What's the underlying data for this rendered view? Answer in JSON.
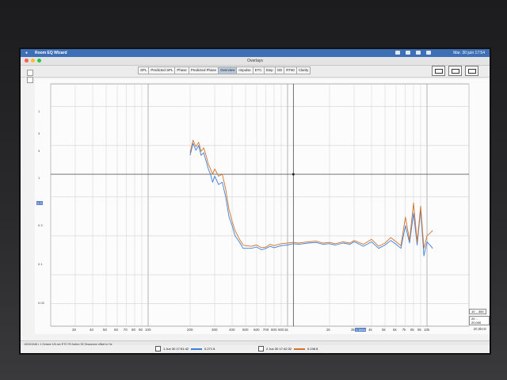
{
  "menubar": {
    "app_name": "Room EQ Wizard",
    "status_time": "Mar. 30 juin  17:54"
  },
  "window": {
    "title": "Overlays"
  },
  "tabs": [
    {
      "label": "SPL"
    },
    {
      "label": "Predicted SPL"
    },
    {
      "label": "Phase"
    },
    {
      "label": "Predicted Phase"
    },
    {
      "label": "Overview",
      "active": true
    },
    {
      "label": "Impulse"
    },
    {
      "label": "ETC"
    },
    {
      "label": "Step"
    },
    {
      "label": "GD"
    },
    {
      "label": "RT60"
    },
    {
      "label": "Clarity"
    }
  ],
  "y_axis_labels": [
    "1",
    "3",
    "3",
    "1",
    "0.3",
    "0.1",
    "0.03"
  ],
  "cursor": {
    "y_value": "0.3",
    "x_value": "1.1kHz"
  },
  "x_axis_labels": [
    "30",
    "40",
    "50",
    "60",
    "70",
    "80",
    "90",
    "100",
    "200",
    "300",
    "400",
    "500",
    "600",
    "700",
    "800",
    "900",
    "1k",
    "2k",
    "3k",
    "4k",
    "5k",
    "6k",
    "7k",
    "8k",
    "9k",
    "10k"
  ],
  "x_unit": "20,0kHz",
  "range_buttons": [
    "10 .. 300",
    "20 .. 20,000"
  ],
  "statusbar": {
    "text": "1024/1048  •  1 Octave 1/6 per  ETC+R  Action 35 Sequence  offset in  Hz"
  },
  "legend": [
    {
      "label": "1 Jun 30 17:51:42",
      "value": "0.271 8",
      "color": "#3d7fd9"
    },
    {
      "label": "2 Jun 30 17:42:32",
      "value": "0.246 8",
      "color": "#d1732c"
    }
  ],
  "chart_data": {
    "type": "line",
    "xscale": "log",
    "xlim": [
      20,
      20000
    ],
    "series": [
      {
        "color": "#3d7fd9",
        "x": [
          200,
          210,
          220,
          230,
          240,
          250,
          260,
          270,
          280,
          290,
          300,
          320,
          340,
          360,
          380,
          400,
          420,
          450,
          480,
          500,
          550,
          600,
          650,
          700,
          750,
          800,
          900,
          1000,
          1100,
          1200,
          1400,
          1600,
          1800,
          2000,
          2200,
          2500,
          2800,
          3000,
          3500,
          4000,
          4500,
          5000,
          5500,
          6000,
          6500,
          7000,
          7500,
          8000,
          8500,
          9000,
          9500,
          10000,
          11000
        ],
        "y": [
          0.42,
          0.52,
          0.46,
          0.5,
          0.42,
          0.44,
          0.38,
          0.33,
          0.3,
          0.26,
          0.29,
          0.25,
          0.26,
          0.2,
          0.14,
          0.12,
          0.1,
          0.09,
          0.08,
          0.08,
          0.08,
          0.082,
          0.078,
          0.08,
          0.083,
          0.081,
          0.084,
          0.085,
          0.087,
          0.086,
          0.088,
          0.089,
          0.086,
          0.087,
          0.085,
          0.088,
          0.086,
          0.09,
          0.083,
          0.09,
          0.08,
          0.085,
          0.092,
          0.086,
          0.08,
          0.12,
          0.088,
          0.15,
          0.085,
          0.16,
          0.07,
          0.09,
          0.08
        ]
      },
      {
        "color": "#d1732c",
        "x": [
          200,
          210,
          220,
          230,
          240,
          250,
          260,
          270,
          280,
          290,
          300,
          320,
          340,
          360,
          380,
          400,
          420,
          450,
          480,
          500,
          550,
          600,
          650,
          700,
          750,
          800,
          900,
          1000,
          1100,
          1200,
          1400,
          1600,
          1800,
          2000,
          2200,
          2500,
          2800,
          3000,
          3500,
          4000,
          4500,
          5000,
          5500,
          6000,
          6500,
          7000,
          7500,
          8000,
          8500,
          9000,
          9500,
          10000,
          11000
        ],
        "y": [
          0.44,
          0.55,
          0.49,
          0.53,
          0.45,
          0.48,
          0.42,
          0.36,
          0.33,
          0.3,
          0.33,
          0.29,
          0.3,
          0.23,
          0.16,
          0.13,
          0.11,
          0.095,
          0.085,
          0.084,
          0.083,
          0.085,
          0.081,
          0.082,
          0.086,
          0.084,
          0.087,
          0.088,
          0.089,
          0.088,
          0.09,
          0.091,
          0.088,
          0.089,
          0.087,
          0.09,
          0.088,
          0.092,
          0.086,
          0.094,
          0.083,
          0.088,
          0.097,
          0.09,
          0.084,
          0.14,
          0.092,
          0.18,
          0.09,
          0.17,
          0.08,
          0.1,
          0.11
        ]
      }
    ],
    "grid": true
  }
}
